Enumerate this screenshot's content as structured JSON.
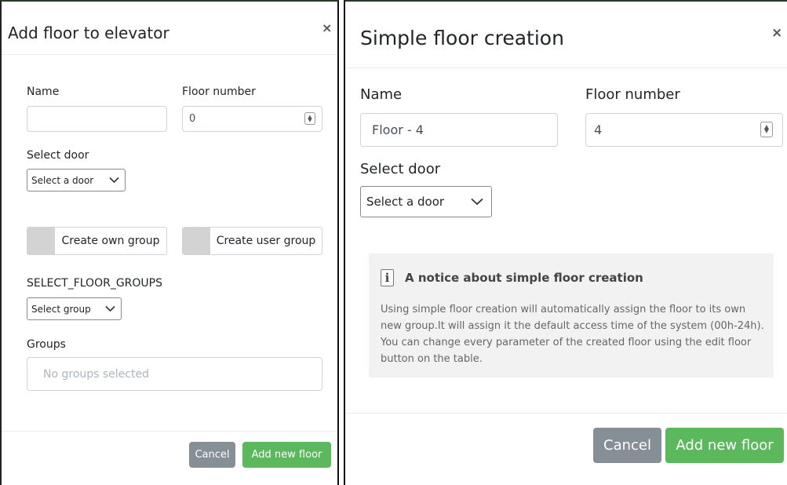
{
  "left": {
    "title": "Add floor to elevator",
    "close": "×",
    "name_label": "Name",
    "name_value": "",
    "floor_label": "Floor number",
    "floor_value": "0",
    "door_label": "Select door",
    "door_select": "Select a door",
    "own_group_label": "Create own group",
    "user_group_label": "Create user group",
    "floor_groups_label": "SELECT_FLOOR_GROUPS",
    "group_select": "Select group",
    "groups_label": "Groups",
    "groups_placeholder": "No groups selected",
    "cancel": "Cancel",
    "add": "Add new floor"
  },
  "right": {
    "title": "Simple floor creation",
    "close": "×",
    "name_label": "Name",
    "name_value": "Floor - 4",
    "floor_label": "Floor number",
    "floor_value": "4",
    "door_label": "Select door",
    "door_select": "Select a door",
    "notice": {
      "icon": "i",
      "title": "A notice about simple floor creation",
      "body": "Using simple floor creation will automatically assign the floor to its own new group.It will assign it the default access time of the system (00h-24h). You can change every parameter of the created floor using the edit floor button on the table."
    },
    "cancel": "Cancel",
    "add": "Add new floor"
  },
  "colors": {
    "green_button": "#5cb85c",
    "gray_button": "#868e96",
    "notice_bg": "#f2f2f2"
  }
}
